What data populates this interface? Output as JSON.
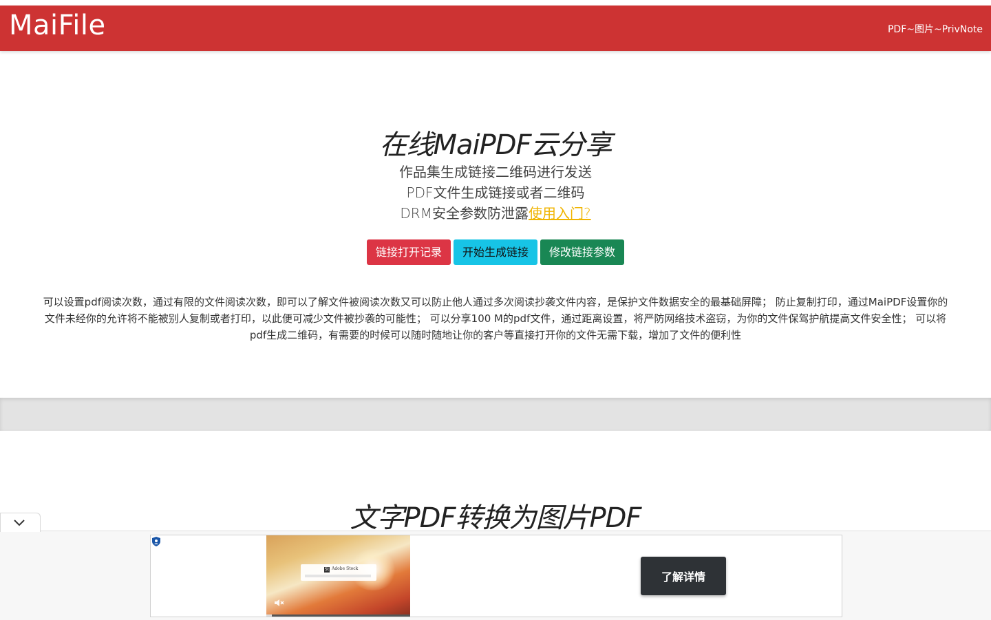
{
  "navbar": {
    "brand": "MaiFile",
    "link": "PDF~图片~PrivNote"
  },
  "hero": {
    "title": "在线MaiPDF云分享",
    "lines": [
      "作品集生成链接二维码进行发送",
      "PDF文件生成链接或者二维码",
      "DRM安全参数防泄露"
    ],
    "help_link": "使用入门?",
    "buttons": {
      "open_log": "链接打开记录",
      "generate": "开始生成链接",
      "modify": "修改链接参数"
    },
    "description": "可以设置pdf阅读次数，通过有限的文件阅读次数，即可以了解文件被阅读次数又可以防止他人通过多次阅读抄袭文件内容，是保护文件数据安全的最基础屏障；  防止复制打印，通过MaiPDF设置你的文件未经你的允许将不能被别人复制或者打印，以此便可减少文件被抄袭的可能性；  可以分享100 M的pdf文件，通过距离设置，将严防网络技术盗窃，为你的文件保驾护航提高文件安全性；  可以将pdf生成二维码，有需要的时候可以随时随地让你的客户等直接打开你的文件无需下载，增加了文件的便利性"
  },
  "section2": {
    "title": "文字PDF转换为图片PDF"
  },
  "ad": {
    "collapse_icon": "chevron-down-icon",
    "thumb_label": "Adobe Stock",
    "cta": "了解详情",
    "video_progress": 0.04
  },
  "colors": {
    "navbar": "#cd3333",
    "btn_red": "#dc3545",
    "btn_cyan": "#17c4e6",
    "btn_green": "#198754",
    "link_yellow": "#f0b400"
  }
}
